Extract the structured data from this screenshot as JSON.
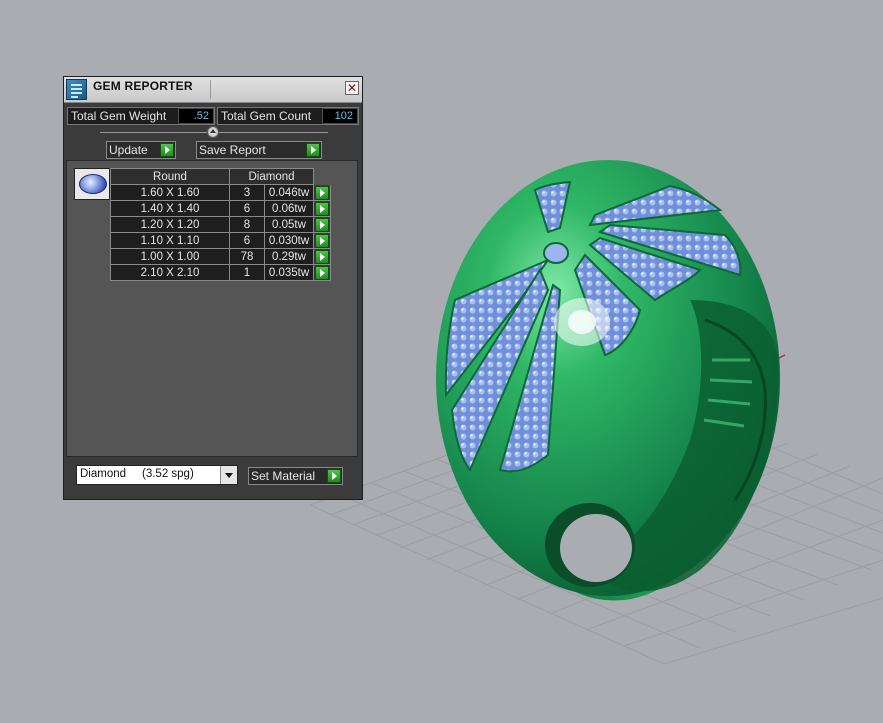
{
  "window": {
    "title": "GEM REPORTER",
    "close_glyph": "✕"
  },
  "totals": {
    "weight_label": "Total Gem Weight",
    "weight_value": ".52",
    "count_label": "Total Gem Count",
    "count_value": "102"
  },
  "actions": {
    "update_label": "Update",
    "save_report_label": "Save Report",
    "set_material_label": "Set Material"
  },
  "gem_table": {
    "headers": [
      "Round",
      "Diamond"
    ],
    "rows": [
      {
        "size": "1.60 X 1.60",
        "count": "3",
        "weight": "0.046tw"
      },
      {
        "size": "1.40 X 1.40",
        "count": "6",
        "weight": "0.06tw"
      },
      {
        "size": "1.20 X 1.20",
        "count": "8",
        "weight": "0.05tw"
      },
      {
        "size": "1.10 X 1.10",
        "count": "6",
        "weight": "0.030tw"
      },
      {
        "size": "1.00 X 1.00",
        "count": "78",
        "weight": "0.29tw"
      },
      {
        "size": "2.10 X 2.10",
        "count": "1",
        "weight": "0.035tw"
      }
    ]
  },
  "material": {
    "selected": "Diamond     (3.52 spg)"
  },
  "icons": {
    "app": "gem-reporter-app-icon",
    "close": "close-icon",
    "gem_thumbnail": "round-gem-icon",
    "dropdown": "chevron-down-icon",
    "go": "play-arrow-icon"
  },
  "colors": {
    "viewport_bg": "#a9adb2",
    "panel_bg": "#3b3b3b",
    "value_text": "#5cc6ee",
    "ring_green": "#1f9a4e",
    "gem_blue": "#8fa9e8",
    "axis_red": "#b03030",
    "axis_green": "#2f8f3f",
    "action_green": "#2fa82b"
  }
}
